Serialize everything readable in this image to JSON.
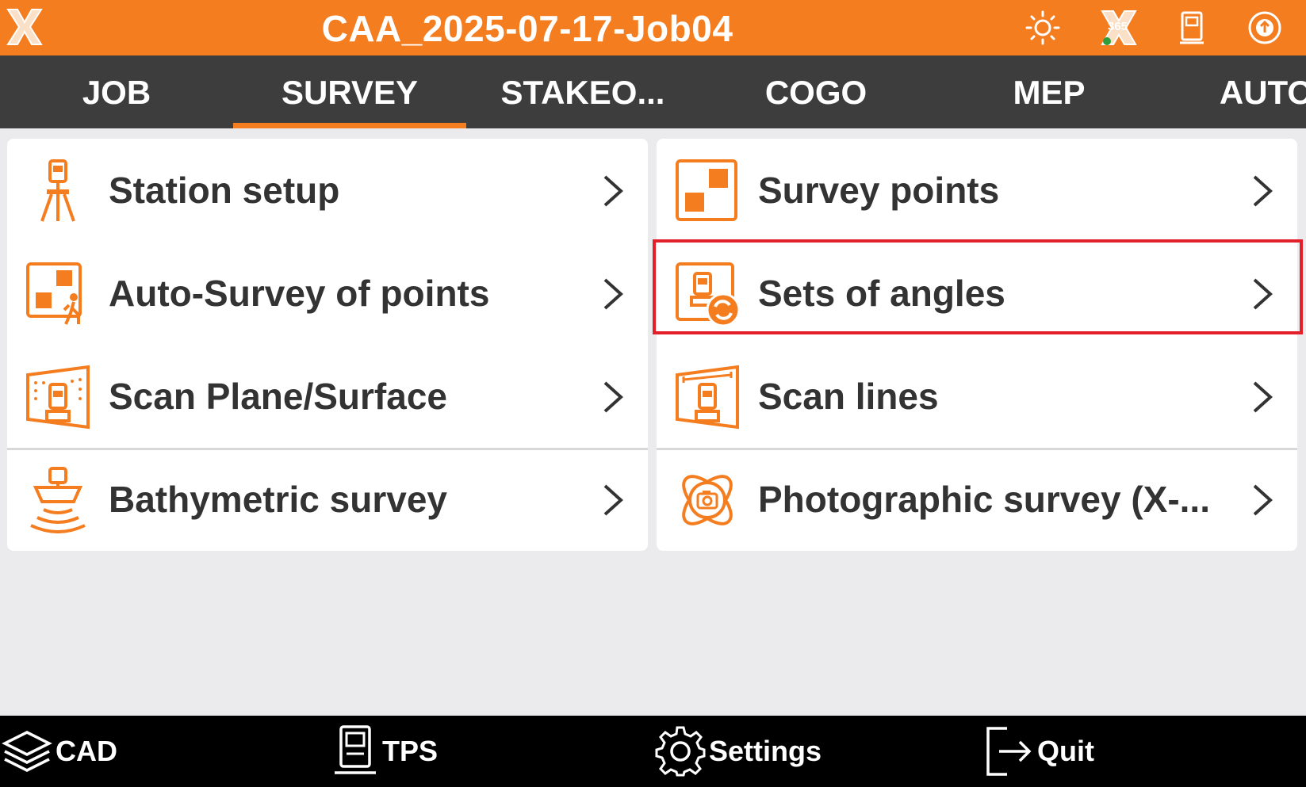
{
  "app": {
    "title": "CAA_2025-07-17-Job04",
    "logo_icon": "app-logo-x-icon",
    "status_icons": [
      "brightness-icon",
      "satellite-365-icon",
      "total-station-icon",
      "connection-icon"
    ],
    "status_badge": "365"
  },
  "tabs": [
    {
      "label": "JOB",
      "active": false
    },
    {
      "label": "SURVEY",
      "active": true
    },
    {
      "label": "STAKEO...",
      "active": false
    },
    {
      "label": "COGO",
      "active": false
    },
    {
      "label": "MEP",
      "active": false
    },
    {
      "label": "AUTO",
      "active": false
    }
  ],
  "left_menu": [
    {
      "label": "Station setup",
      "icon": "tripod-instrument-icon"
    },
    {
      "label": "Auto-Survey of points",
      "icon": "auto-survey-walker-icon"
    },
    {
      "label": "Scan Plane/Surface",
      "icon": "scan-plane-icon"
    },
    {
      "label": "Bathymetric survey",
      "icon": "bathymetric-boat-icon"
    }
  ],
  "right_menu": [
    {
      "label": "Survey points",
      "icon": "survey-points-icon"
    },
    {
      "label": "Sets of angles",
      "icon": "sets-of-angles-icon",
      "highlighted": true
    },
    {
      "label": "Scan lines",
      "icon": "scan-lines-icon"
    },
    {
      "label": "Photographic survey (X-...",
      "icon": "photographic-survey-icon"
    }
  ],
  "bottom": {
    "cad": "CAD",
    "tps": "TPS",
    "settings": "Settings",
    "quit": "Quit"
  },
  "colors": {
    "accent": "#f47d20",
    "tabbar": "#3d3d3d",
    "highlight": "#e3202a",
    "background": "#ebebed"
  }
}
